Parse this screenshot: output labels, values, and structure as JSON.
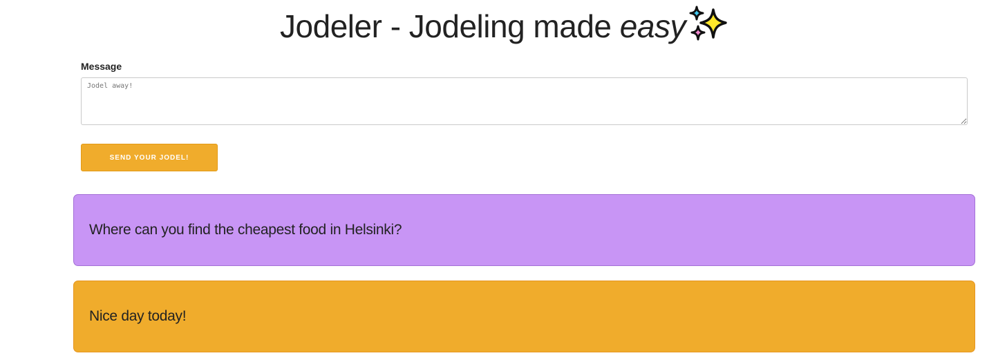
{
  "header": {
    "title_prefix": "Jodeler - Jodeling made ",
    "title_emphasis": "easy",
    "icon": "sparkles-icon"
  },
  "form": {
    "message_label": "Message",
    "message_placeholder": "Jodel away!",
    "message_value": "",
    "send_label": "SEND YOUR JODEL!"
  },
  "jodels": [
    {
      "text": "Where can you find the cheapest food in Helsinki?",
      "color": "#c895f5"
    },
    {
      "text": "Nice day today!",
      "color": "#f0ac2c"
    }
  ],
  "colors": {
    "accent": "#f0ac2c",
    "purple": "#c895f5"
  }
}
